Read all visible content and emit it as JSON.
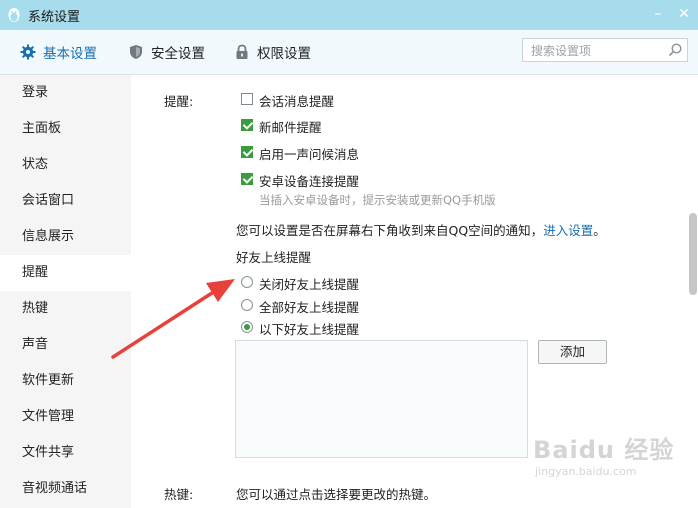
{
  "window": {
    "title": "系统设置",
    "minimize": "–",
    "close": "✕"
  },
  "tabs": [
    {
      "label": "基本设置",
      "icon": "gear-icon",
      "active": true
    },
    {
      "label": "安全设置",
      "icon": "shield-icon",
      "active": false
    },
    {
      "label": "权限设置",
      "icon": "lock-icon",
      "active": false
    }
  ],
  "search": {
    "placeholder": "搜索设置项",
    "value": ""
  },
  "sidebar": {
    "items": [
      {
        "label": "登录"
      },
      {
        "label": "主面板"
      },
      {
        "label": "状态"
      },
      {
        "label": "会话窗口"
      },
      {
        "label": "信息展示"
      },
      {
        "label": "提醒",
        "active": true
      },
      {
        "label": "热键"
      },
      {
        "label": "声音"
      },
      {
        "label": "软件更新"
      },
      {
        "label": "文件管理"
      },
      {
        "label": "文件共享"
      },
      {
        "label": "音视频通话"
      }
    ]
  },
  "reminder": {
    "section_label": "提醒:",
    "options": [
      {
        "label": "会话消息提醒",
        "checked": false
      },
      {
        "label": "新邮件提醒",
        "checked": true
      },
      {
        "label": "启用一声问候消息",
        "checked": true
      },
      {
        "label": "安卓设备连接提醒",
        "checked": true
      }
    ],
    "android_hint": "当插入安卓设备时，提示安装或更新QQ手机版",
    "qzone_text": "您可以设置是否在屏幕右下角收到来自QQ空间的通知，",
    "qzone_link": "进入设置",
    "qzone_end": "。",
    "friend_online_title": "好友上线提醒",
    "friend_online_options": [
      {
        "label": "关闭好友上线提醒",
        "selected": false
      },
      {
        "label": "全部好友上线提醒",
        "selected": false
      },
      {
        "label": "以下好友上线提醒",
        "selected": true
      }
    ],
    "add_button": "添加"
  },
  "hotkey": {
    "section_label": "热键:",
    "description": "您可以通过点击选择要更改的热键。"
  },
  "watermark": {
    "brand": "Baidu 经验",
    "url": "jingyan.baidu.com"
  },
  "colors": {
    "titlebar": "#a7dced",
    "accent": "#1a6fb0",
    "check_green": "#3a9c3e",
    "arrow_red": "#e8403a"
  }
}
